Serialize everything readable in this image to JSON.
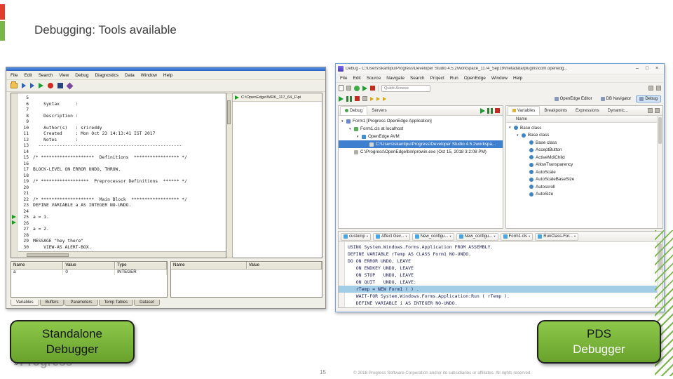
{
  "slide": {
    "title": "Debugging: Tools available",
    "page_number": "15",
    "copyright": "© 2018 Progress Software Corporation and/or its subsidiaries or affiliates. All rights reserved.",
    "logo_text": "Progress",
    "logo_mark": "»"
  },
  "callouts": {
    "standalone": {
      "line1": "Standalone",
      "line2": "Debugger"
    },
    "pds": {
      "line1": "PDS",
      "line2": "Debugger"
    }
  },
  "sad": {
    "menu": [
      "File",
      "Edit",
      "Search",
      "View",
      "Debug",
      "Diagnostics",
      "Data",
      "Window",
      "Help"
    ],
    "session_path": "C:\\OpenEdge\\WRK_117_64_F\\pi",
    "code": [
      {
        "n": "5",
        "t": ""
      },
      {
        "n": "6",
        "t": "    Syntax      :"
      },
      {
        "n": "7",
        "t": ""
      },
      {
        "n": "8",
        "t": "    Description :"
      },
      {
        "n": "9",
        "t": ""
      },
      {
        "n": "10",
        "t": "    Author(s)   : srireddy"
      },
      {
        "n": "11",
        "t": "    Created     : Mon Oct 23 14:13:41 IST 2017"
      },
      {
        "n": "12",
        "t": "    Notes       :"
      },
      {
        "n": "13",
        "t": "  ------------------------------------------------------"
      },
      {
        "n": "14",
        "t": ""
      },
      {
        "n": "15",
        "t": "/* ********************  Definitions  ***************** */"
      },
      {
        "n": "16",
        "t": ""
      },
      {
        "n": "17",
        "t": "BLOCK-LEVEL ON ERROR UNDO, THROW."
      },
      {
        "n": "18",
        "t": ""
      },
      {
        "n": "19",
        "t": "/* ******************  Preprocessor Definitions  ****** */"
      },
      {
        "n": "20",
        "t": ""
      },
      {
        "n": "21",
        "t": ""
      },
      {
        "n": "22",
        "t": "/* ********************  Main Block  ****************** */"
      },
      {
        "n": "23",
        "t": "DEFINE VARIABLE a AS INTEGER NO-UNDO."
      },
      {
        "n": "24",
        "t": ""
      },
      {
        "n": "25",
        "t": "a = 1."
      },
      {
        "n": "26",
        "t": ""
      },
      {
        "n": "27",
        "t": "a = 2."
      },
      {
        "n": "28",
        "t": ""
      },
      {
        "n": "29",
        "t": "MESSAGE \"hey there\""
      },
      {
        "n": "30",
        "t": "    VIEW-AS ALERT-BOX."
      }
    ],
    "vars_headers": [
      "Name",
      "Value",
      "Type"
    ],
    "vars_rows": [
      [
        "a",
        "0",
        "INTEGER"
      ]
    ],
    "watch_headers": [
      "Name",
      "Value"
    ],
    "tabs": [
      "Variables",
      "Buffers",
      "Parameters",
      "Temp Tables",
      "Dataset"
    ]
  },
  "pds": {
    "window_title": "Debug - C:\\Users\\skantipu\\Progress\\Developer Studio 4.5.2\\workspace_1174_Sep19\\metadata\\plugins\\com.openedg...",
    "window_controls": {
      "minimize": "–",
      "maximize": "□",
      "close": "×"
    },
    "menu": [
      "File",
      "Edit",
      "Source",
      "Navigate",
      "Search",
      "Project",
      "Run",
      "OpenEdge",
      "Window",
      "Help"
    ],
    "quick_access_placeholder": "Quick Access",
    "perspectives": [
      "OpenEdge Editor",
      "DB Navigator",
      "Debug"
    ],
    "left_panel_tabs": [
      "Debug",
      "Servers"
    ],
    "debug_tree": [
      {
        "d": 0,
        "c": "▾",
        "t": "Form1 [Progress OpenEdge Application]",
        "cls": "i-app"
      },
      {
        "d": 1,
        "c": "▾",
        "t": "Form1.cls at localhost",
        "cls": "i-cls"
      },
      {
        "d": 2,
        "c": "▾",
        "t": "OpenEdge AVM",
        "cls": "i-avm"
      },
      {
        "d": 3,
        "c": "",
        "t": "C:\\Users\\skantipu\\Progress\\Developer Studio 4.5.2workspa...",
        "cls": "sel i-frame"
      },
      {
        "d": 1,
        "c": "",
        "t": "C:\\Progress\\OpenEdge\\bin\\prowin.exe (Oct 15, 2018 3:2:08 PM)",
        "cls": "i-exe"
      }
    ],
    "right_panel_tabs": [
      "Variables",
      "Breakpoints",
      "Expressions",
      "Dynamic..."
    ],
    "vars_col_header": "Name",
    "vars_tree": [
      {
        "d": 0,
        "c": "▾",
        "t": "Base class"
      },
      {
        "d": 1,
        "c": "▾",
        "t": "Base class"
      },
      {
        "d": 2,
        "c": "",
        "t": "Base class"
      },
      {
        "d": 2,
        "c": "",
        "t": "AcceptButton"
      },
      {
        "d": 2,
        "c": "",
        "t": "ActiveMdiChild"
      },
      {
        "d": 2,
        "c": "",
        "t": "AllowTransparency"
      },
      {
        "d": 2,
        "c": "",
        "t": "AutoScale"
      },
      {
        "d": 2,
        "c": "",
        "t": "AutoScaleBaseSize"
      },
      {
        "d": 2,
        "c": "",
        "t": "Autoscroll"
      },
      {
        "d": 2,
        "c": "",
        "t": "AutoSize"
      }
    ],
    "launch_buttons": [
      "customp",
      "Affect Gev...",
      "New_configu...",
      "New_configu...",
      "Form1.cls",
      "RunClass-For..."
    ],
    "code": [
      {
        "t": "USING System.Windows.Forms.Application FROM ASSEMBLY."
      },
      {
        "t": "DEFINE VARIABLE rTemp AS CLASS Form1 NO-UNDO."
      },
      {
        "t": "DO ON ERROR UNDO, LEAVE"
      },
      {
        "t": "   ON ENDKEY UNDO, LEAVE"
      },
      {
        "t": "   ON STOP   UNDO, LEAVE"
      },
      {
        "t": "   ON QUIT   UNDO, LEAVE:"
      },
      {
        "t": "   rTemp = NEW Form1 ( ) .",
        "cls": "hl"
      },
      {
        "t": "   WAIT-FOR System.Windows.Forms.Application:Run ( rTemp )."
      },
      {
        "t": "   DEFINE VARIABLE i AS INTEGER NO-UNDO."
      }
    ]
  }
}
